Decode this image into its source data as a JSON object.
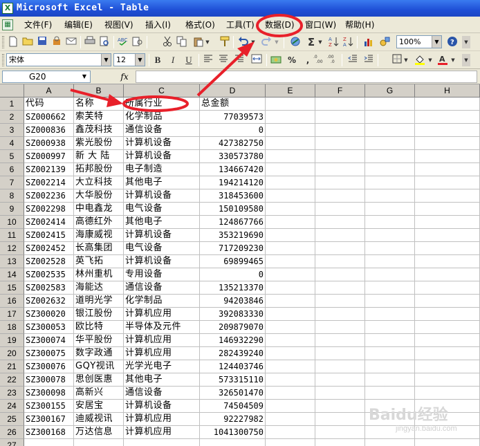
{
  "window": {
    "title": "Microsoft Excel - Table",
    "app_icon_glyph": "X"
  },
  "menubar": {
    "items": [
      {
        "label": "文件(F)"
      },
      {
        "label": "编辑(E)"
      },
      {
        "label": "视图(V)"
      },
      {
        "label": "插入(I)"
      },
      {
        "label": "格式(O)"
      },
      {
        "label": "工具(T)"
      },
      {
        "label": "数据(D)"
      },
      {
        "label": "窗口(W)"
      },
      {
        "label": "帮助(H)"
      }
    ]
  },
  "toolbar_standard": {
    "zoom": "100%",
    "icons": [
      "new-icon",
      "open-icon",
      "save-icon",
      "permission-icon",
      "email-icon",
      "print-icon",
      "print-preview-icon",
      "spelling-icon",
      "research-icon",
      "cut-icon",
      "copy-icon",
      "paste-icon",
      "format-painter-icon",
      "undo-icon",
      "redo-icon",
      "hyperlink-icon",
      "autosum-icon",
      "sort-ascending-icon",
      "sort-descending-icon",
      "chart-wizard-icon",
      "drawing-icon",
      "help-icon"
    ]
  },
  "toolbar_format": {
    "font": "宋体",
    "size": "12",
    "bold": "B",
    "italic": "I",
    "underline": "U",
    "percent": "%",
    "comma": ","
  },
  "formula_bar": {
    "name_box": "G20",
    "fx": "fx",
    "value": ""
  },
  "grid": {
    "columns": [
      "A",
      "B",
      "C",
      "D",
      "E",
      "F",
      "G",
      "H"
    ],
    "headers": [
      "代码",
      "名称",
      "所属行业",
      "总金额"
    ],
    "rows": [
      [
        "SZ000662",
        "索芙特",
        "化学制品",
        "77039573"
      ],
      [
        "SZ000836",
        "鑫茂科技",
        "通信设备",
        "0"
      ],
      [
        "SZ000938",
        "紫光股份",
        "计算机设备",
        "427382750"
      ],
      [
        "SZ000997",
        "新 大 陆",
        "计算机设备",
        "330573780"
      ],
      [
        "SZ002139",
        "拓邦股份",
        "电子制造",
        "134667420"
      ],
      [
        "SZ002214",
        "大立科技",
        "其他电子",
        "194214120"
      ],
      [
        "SZ002236",
        "大华股份",
        "计算机设备",
        "318453600"
      ],
      [
        "SZ002298",
        "中电鑫龙",
        "电气设备",
        "150109580"
      ],
      [
        "SZ002414",
        "高德红外",
        "其他电子",
        "124867766"
      ],
      [
        "SZ002415",
        "海康威视",
        "计算机设备",
        "353219690"
      ],
      [
        "SZ002452",
        "长高集团",
        "电气设备",
        "717209230"
      ],
      [
        "SZ002528",
        "英飞拓",
        "计算机设备",
        "69899465"
      ],
      [
        "SZ002535",
        "林州重机",
        "专用设备",
        "0"
      ],
      [
        "SZ002583",
        "海能达",
        "通信设备",
        "135213370"
      ],
      [
        "SZ002632",
        "道明光学",
        "化学制品",
        "94203846"
      ],
      [
        "SZ300020",
        "银江股份",
        "计算机应用",
        "392083330"
      ],
      [
        "SZ300053",
        "欧比特",
        "半导体及元件",
        "209879070"
      ],
      [
        "SZ300074",
        "华平股份",
        "计算机应用",
        "146932290"
      ],
      [
        "SZ300075",
        "数字政通",
        "计算机应用",
        "282439240"
      ],
      [
        "SZ300076",
        "GQY视讯",
        "光学光电子",
        "124403746"
      ],
      [
        "SZ300078",
        "思创医惠",
        "其他电子",
        "573315110"
      ],
      [
        "SZ300098",
        "高新兴",
        "通信设备",
        "326501470"
      ],
      [
        "SZ300155",
        "安居宝",
        "计算机设备",
        "74504509"
      ],
      [
        "SZ300167",
        "迪威视讯",
        "计算机应用",
        "92227982"
      ],
      [
        "SZ300168",
        "万达信息",
        "计算机应用",
        "1041300750"
      ]
    ],
    "row_numbers": [
      "1",
      "2",
      "3",
      "4",
      "5",
      "6",
      "7",
      "8",
      "9",
      "10",
      "11",
      "12",
      "13",
      "14",
      "15",
      "16",
      "17",
      "18",
      "19",
      "20",
      "21",
      "22",
      "23",
      "24",
      "25",
      "26",
      "27"
    ]
  },
  "annotation_color": "#e8202a",
  "watermark": {
    "brand": "Baidu经验",
    "sub": "jingyan.baidu.com"
  }
}
